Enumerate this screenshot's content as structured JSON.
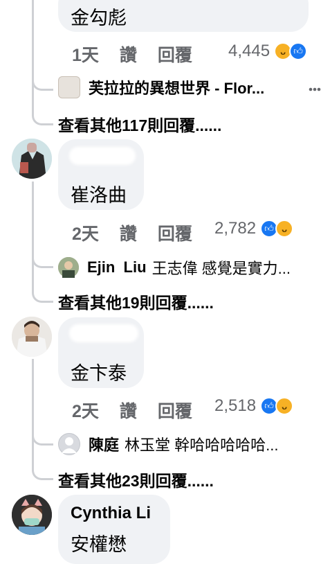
{
  "comments": [
    {
      "text": "金勾彪",
      "time": "1天",
      "like_label": "讚",
      "reply_label": "回覆",
      "reaction_count": "4,445",
      "reply_preview": {
        "name": "芙拉拉的異想世界 - Flor...",
        "text": ""
      },
      "more_replies": "查看其他117則回覆......"
    },
    {
      "author": "",
      "text": "崔洛曲",
      "time": "2天",
      "like_label": "讚",
      "reply_label": "回覆",
      "reaction_count": "2,782",
      "reply_preview": {
        "name": "Ejin  Liu",
        "text": "王志偉 感覺是實力..."
      },
      "more_replies": "查看其他19則回覆......"
    },
    {
      "author": "",
      "text": "金卞泰",
      "time": "2天",
      "like_label": "讚",
      "reply_label": "回覆",
      "reaction_count": "2,518",
      "reply_preview": {
        "name": "陳庭",
        "text": "林玉堂 幹哈哈哈哈哈..."
      },
      "more_replies": "查看其他23則回覆......"
    },
    {
      "author": "Cynthia Li",
      "text": "安權懋"
    }
  ],
  "colors": {
    "bubble": "#f0f2f5",
    "like_blue": "#1877f2",
    "haha_yellow": "#f7b125",
    "meta_gray": "#65676b"
  },
  "icons": [
    "like-reaction-icon",
    "haha-reaction-icon",
    "more-options-icon"
  ]
}
